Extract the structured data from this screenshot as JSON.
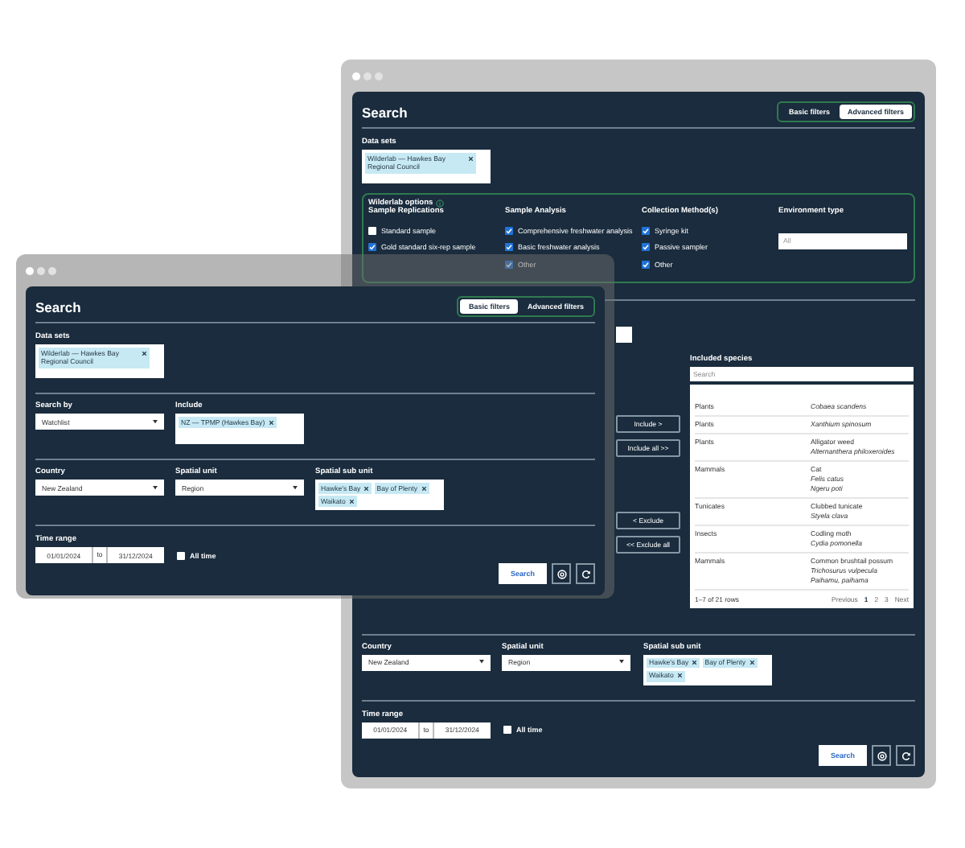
{
  "back_window": {
    "title": "Search",
    "tabs": [
      {
        "label": "Basic filters",
        "selected": false
      },
      {
        "label": "Advanced filters",
        "selected": true
      }
    ],
    "data_sets": {
      "label": "Data sets",
      "tags": [
        "Wilderlab — Hawkes Bay Regional Council"
      ]
    },
    "options": {
      "title": "Wilderlab options",
      "groups": [
        {
          "kind": "checkboxes",
          "heading": "Sample Replications",
          "items": [
            {
              "label": "Standard sample",
              "checked": false
            },
            {
              "label": "Gold standard six-rep sample",
              "checked": true
            }
          ]
        },
        {
          "kind": "checkboxes",
          "heading": "Sample Analysis",
          "items": [
            {
              "label": "Comprehensive freshwater analysis",
              "checked": true
            },
            {
              "label": "Basic freshwater analysis",
              "checked": true
            },
            {
              "label": "Other",
              "checked": true
            }
          ]
        },
        {
          "kind": "checkboxes",
          "heading": "Collection Method(s)",
          "items": [
            {
              "label": "Syringe kit",
              "checked": true
            },
            {
              "label": "Passive sampler",
              "checked": true
            },
            {
              "label": "Other",
              "checked": true
            }
          ]
        },
        {
          "kind": "select",
          "heading": "Environment type",
          "placeholder": "All"
        }
      ]
    },
    "transfer_buttons": [
      "Include >",
      "Include all >>",
      "< Exclude",
      "<< Exclude all"
    ],
    "species": {
      "label": "Included species",
      "search_placeholder": "Search",
      "rows": [
        {
          "group": "Plants",
          "names": [
            {
              "text": "Cobaea scandens",
              "italic": true
            }
          ]
        },
        {
          "group": "Plants",
          "names": [
            {
              "text": "Xanthium spinosum",
              "italic": true
            }
          ]
        },
        {
          "group": "Plants",
          "names": [
            {
              "text": "Alligator weed",
              "italic": false
            },
            {
              "text": "Alternanthera philoxeroides",
              "italic": true
            }
          ]
        },
        {
          "group": "Mammals",
          "names": [
            {
              "text": "Cat",
              "italic": false
            },
            {
              "text": "Felis catus",
              "italic": true
            },
            {
              "text": "Ngeru poti",
              "italic": true
            }
          ]
        },
        {
          "group": "Tunicates",
          "names": [
            {
              "text": "Clubbed tunicate",
              "italic": false
            },
            {
              "text": "Styela clava",
              "italic": true
            }
          ]
        },
        {
          "group": "Insects",
          "names": [
            {
              "text": "Codling moth",
              "italic": false
            },
            {
              "text": "Cydia pomonella",
              "italic": true
            }
          ]
        },
        {
          "group": "Mammals",
          "names": [
            {
              "text": "Common brushtail possum",
              "italic": false
            },
            {
              "text": "Trichosurus vulpecula",
              "italic": true
            },
            {
              "text": "Paihamu, paihama",
              "italic": true
            }
          ]
        }
      ],
      "row_count": "1–7 of 21 rows",
      "pager": [
        {
          "label": "Previous",
          "selected": false
        },
        {
          "label": "1",
          "selected": true
        },
        {
          "label": "2",
          "selected": false
        },
        {
          "label": "3",
          "selected": false
        },
        {
          "label": "Next",
          "selected": false
        }
      ]
    },
    "location": {
      "fields": [
        {
          "kind": "select",
          "label": "Country",
          "value": "New Zealand"
        },
        {
          "kind": "select",
          "label": "Spatial unit",
          "value": "Region"
        },
        {
          "kind": "tags",
          "label": "Spatial sub unit",
          "tags": [
            "Hawke's Bay",
            "Bay of Plenty",
            "Waikato"
          ]
        }
      ]
    },
    "time_range": {
      "label": "Time range",
      "from": "01/01/2024",
      "separator": "to",
      "to": "31/12/2024",
      "all_time": {
        "label": "All time",
        "checked": false
      }
    },
    "search_button": "Search"
  },
  "front_window": {
    "title": "Search",
    "tabs": [
      {
        "label": "Basic filters",
        "selected": true
      },
      {
        "label": "Advanced filters",
        "selected": false
      }
    ],
    "data_sets": {
      "label": "Data sets",
      "tags": [
        "Wilderlab — Hawkes Bay Regional Council"
      ]
    },
    "criteria": {
      "fields": [
        {
          "kind": "select",
          "label": "Search by",
          "value": "Watchlist"
        },
        {
          "kind": "tags",
          "label": "Include",
          "tags": [
            "NZ — TPMP (Hawkes Bay)"
          ]
        }
      ]
    },
    "location": {
      "fields": [
        {
          "kind": "select",
          "label": "Country",
          "value": "New Zealand"
        },
        {
          "kind": "select",
          "label": "Spatial unit",
          "value": "Region"
        },
        {
          "kind": "tags",
          "label": "Spatial sub unit",
          "tags": [
            "Hawke's Bay",
            "Bay of Plenty",
            "Waikato"
          ]
        }
      ]
    },
    "time_range": {
      "label": "Time range",
      "from": "01/01/2024",
      "separator": "to",
      "to": "31/12/2024",
      "all_time": {
        "label": "All time",
        "checked": false
      }
    },
    "search_button": "Search"
  }
}
